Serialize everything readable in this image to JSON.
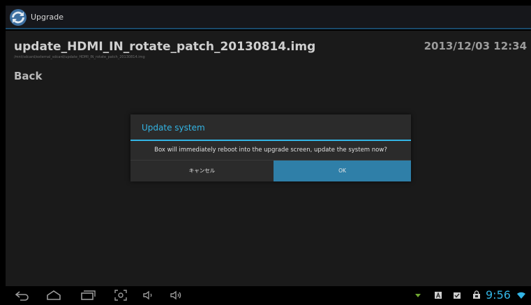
{
  "app": {
    "title": "Upgrade"
  },
  "file": {
    "name": "update_HDMI_IN_rotate_patch_20130814.img",
    "path": "/mnt/sdcard/external_sdcard/update_HDMI_IN_rotate_patch_20130814.img",
    "date": "2013/12/03 12:34"
  },
  "list": {
    "back_label": "Back"
  },
  "dialog": {
    "title": "Update system",
    "message": "Box will immediately reboot into the upgrade screen, update the system now?",
    "cancel_label": "キャンセル",
    "ok_label": "OK"
  },
  "navbar": {
    "icons": [
      "back-icon",
      "home-icon",
      "recent-apps-icon",
      "screenshot-icon",
      "volume-down-icon",
      "volume-up-icon"
    ]
  },
  "status": {
    "icons": [
      "download-icon",
      "notification-a-icon",
      "checkbox-icon",
      "store-icon",
      "wifi-icon"
    ],
    "time": "9:56"
  },
  "colors": {
    "accent": "#33b5e5",
    "ok_button": "#2f7fa8"
  }
}
